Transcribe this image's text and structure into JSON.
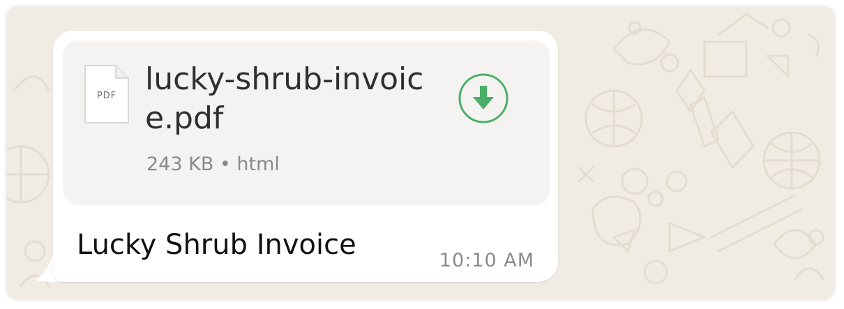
{
  "message": {
    "file": {
      "type_label": "PDF",
      "name": "lucky-shrub-invoice.pdf",
      "meta": "243 KB • html",
      "icon": "pdf-file-icon",
      "action_icon": "download-icon"
    },
    "caption": "Lucky Shrub Invoice",
    "time": "10:10 AM"
  },
  "colors": {
    "wallpaper": "#f0ebe3",
    "bubble": "#ffffff",
    "file_card": "#f4f3f1",
    "download_accent": "#4caf68"
  }
}
